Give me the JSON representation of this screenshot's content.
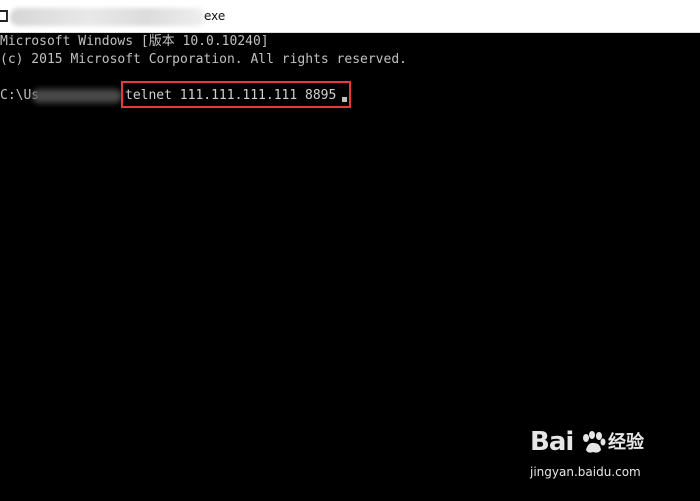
{
  "window": {
    "title_suffix": "exe"
  },
  "console": {
    "line1": "Microsoft Windows [版本 10.0.10240]",
    "line2": "(c) 2015 Microsoft Corporation. All rights reserved.",
    "prompt_prefix": "C:\\Us",
    "command": "telnet 111.111.111.111 8895"
  },
  "highlight": {
    "color": "#e8383a"
  },
  "watermark": {
    "logo_text": "Bai",
    "suffix_text": "经验",
    "domain_text": "jingyan.baidu.com"
  }
}
